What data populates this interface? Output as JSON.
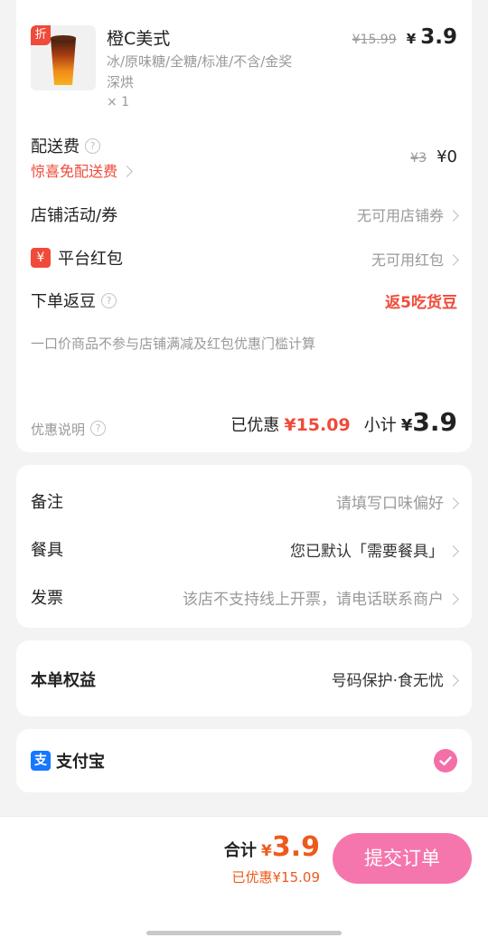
{
  "product": {
    "discount_tag": "折",
    "name": "橙C美式",
    "specs_line1": "冰/原味糖/全糖/标准/不含/金奖",
    "specs_line2": "深烘",
    "quantity": "× 1",
    "original_price": "¥15.99",
    "price_symbol": "¥",
    "price": "3.9"
  },
  "delivery": {
    "label": "配送费",
    "promo": "惊喜免配送费",
    "original": "¥3",
    "current": "¥0"
  },
  "store_coupon": {
    "label": "店铺活动/券",
    "value": "无可用店铺券"
  },
  "red_packet": {
    "icon_glyph": "¥",
    "label": "平台红包",
    "value": "无可用红包"
  },
  "beans": {
    "label": "下单返豆",
    "value": "返5吃货豆"
  },
  "notice": "一口价商品不参与店铺满减及红包优惠门槛计算",
  "summary": {
    "discount_note": "优惠说明",
    "saved_label": "已优惠",
    "saved_value": "¥15.09",
    "subtotal_label": "小计",
    "subtotal_symbol": "¥",
    "subtotal_value": "3.9"
  },
  "remarks": {
    "label": "备注",
    "placeholder": "请填写口味偏好"
  },
  "utensils": {
    "label": "餐具",
    "value": "您已默认「需要餐具」"
  },
  "invoice": {
    "label": "发票",
    "value": "该店不支持线上开票，请电话联系商户"
  },
  "benefits": {
    "label": "本单权益",
    "value": "号码保护·食无忧"
  },
  "payment": {
    "icon_glyph": "支",
    "label": "支付宝"
  },
  "footer": {
    "total_label": "合计",
    "total_symbol": "¥",
    "total_value": "3.9",
    "saved": "已优惠¥15.09",
    "submit_label": "提交订单"
  }
}
